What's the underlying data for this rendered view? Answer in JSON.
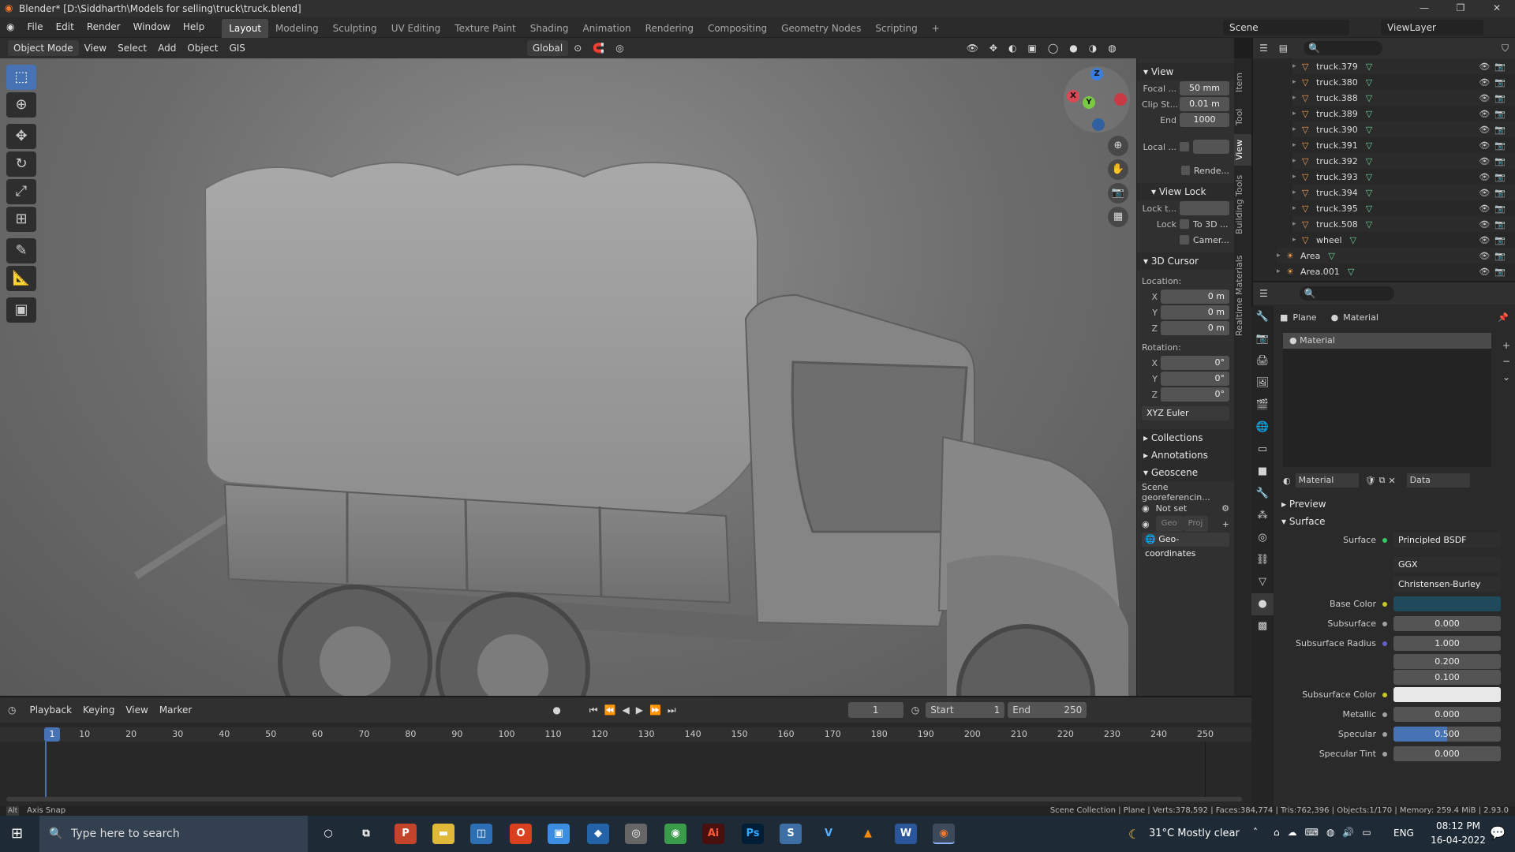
{
  "titlebar": {
    "title": "Blender* [D:\\Siddharth\\Models for selling\\truck\\truck.blend]"
  },
  "menus": [
    "File",
    "Edit",
    "Render",
    "Window",
    "Help"
  ],
  "workspaces": [
    "Layout",
    "Modeling",
    "Sculpting",
    "UV Editing",
    "Texture Paint",
    "Shading",
    "Animation",
    "Rendering",
    "Compositing",
    "Geometry Nodes",
    "Scripting"
  ],
  "top_right": {
    "scene": "Scene",
    "view_layer": "ViewLayer"
  },
  "viewport_header": {
    "mode": "Object Mode",
    "view": "View",
    "select": "Select",
    "add": "Add",
    "object": "Object",
    "gis": "GIS",
    "orientation": "Global"
  },
  "gizmo": {
    "x": "X",
    "y": "Y",
    "z": "Z"
  },
  "npanel": {
    "tabs": [
      "Item",
      "Tool",
      "View",
      "Building Tools",
      "Realtime Materials"
    ],
    "view_section": "View",
    "focal_label": "Focal ...",
    "focal_value": "50 mm",
    "clip_start_label": "Clip St...",
    "clip_start_value": "0.01 m",
    "end_label": "End",
    "end_value": "1000",
    "local_label": "Local ...",
    "render_label": "Rende...",
    "view_lock": "View Lock",
    "lock_to_label": "Lock t...",
    "lock_label": "Lock",
    "to_3d_label": "To 3D ...",
    "camera_label": "Camer...",
    "cursor_section": "3D Cursor",
    "location_label": "Location:",
    "loc_x": "0 m",
    "loc_y": "0 m",
    "loc_z": "0 m",
    "rotation_label": "Rotation:",
    "rot_x": "0°",
    "rot_y": "0°",
    "rot_z": "0°",
    "rot_mode": "XYZ Euler",
    "collections": "Collections",
    "annotations": "Annotations",
    "geoscene": "Geoscene",
    "georef_label": "Scene georeferencin...",
    "not_set": "Not set",
    "geo_btn": "Geo",
    "proj_btn": "Proj",
    "geo_coords": "Geo-coordinates",
    "axis_x": "X",
    "axis_y": "Y",
    "axis_z": "Z"
  },
  "outliner": {
    "items": [
      "truck.379",
      "truck.380",
      "truck.388",
      "truck.389",
      "truck.390",
      "truck.391",
      "truck.392",
      "truck.393",
      "truck.394",
      "truck.395",
      "truck.508",
      "wheel",
      "Area",
      "Area.001"
    ]
  },
  "properties": {
    "breadcrumb_obj": "Plane",
    "breadcrumb_mat": "Material",
    "slot": "Material",
    "mat_name": "Material",
    "data_label": "Data",
    "preview": "Preview",
    "surface_section": "Surface",
    "surface_label": "Surface",
    "surface_value": "Principled BSDF",
    "distribution": "GGX",
    "sss_method": "Christensen-Burley",
    "base_color_label": "Base Color",
    "base_color": "#1e4a5c",
    "subsurface_label": "Subsurface",
    "subsurface": "0.000",
    "ss_radius_label": "Subsurface Radius",
    "ss_r1": "1.000",
    "ss_r2": "0.200",
    "ss_r3": "0.100",
    "ss_color_label": "Subsurface Color",
    "metallic_label": "Metallic",
    "metallic": "0.000",
    "specular_label": "Specular",
    "specular": "0.500",
    "specular_fill": 0.5,
    "specular_tint_label": "Specular Tint",
    "specular_tint": "0.000"
  },
  "timeline": {
    "playback": "Playback",
    "keying": "Keying",
    "view": "View",
    "marker": "Marker",
    "current_frame": "1",
    "start_label": "Start",
    "start": "1",
    "end_label": "End",
    "end": "250",
    "frame_labels": [
      "1",
      "10",
      "20",
      "30",
      "40",
      "50",
      "60",
      "70",
      "80",
      "90",
      "100",
      "110",
      "120",
      "130",
      "140",
      "150",
      "160",
      "170",
      "180",
      "190",
      "200",
      "210",
      "220",
      "230",
      "240",
      "250"
    ]
  },
  "statusbar": {
    "left": "Axis Snap",
    "left_key": "Alt",
    "right": "Scene Collection | Plane | Verts:378,592 | Faces:384,774 | Tris:762,396 | Objects:1/170 | Memory: 259.4 MiB | 2.93.0"
  },
  "taskbar": {
    "search": "Type here to search",
    "weather": "31°C  Mostly clear",
    "lang": "ENG",
    "time": "08:12 PM",
    "date": "16-04-2022"
  }
}
